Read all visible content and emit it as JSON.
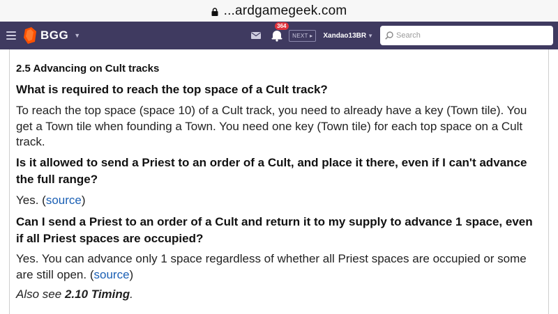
{
  "browser": {
    "domain": "...ardgamegeek.com"
  },
  "nav": {
    "logo_text": "BGG",
    "notification_count": "364",
    "next_label": "NEXT ▸",
    "username": "Xandao13BR",
    "search_placeholder": "Search"
  },
  "content": {
    "section_title": "2.5 Advancing on Cult tracks",
    "q1": "What is required to reach the top space of a Cult track?",
    "a1": "To reach the top space (space 10) of a Cult track, you need to already have a key (Town tile). You get a Town tile when founding a Town. You need one key (Town tile) for each top space on a Cult track.",
    "q2": "Is it allowed to send a Priest to an order of a Cult, and place it there, even if I can't advance the full range?",
    "a2_text": "Yes. (",
    "a2_link": "source",
    "a2_end": ")",
    "q3": "Can I send a Priest to an order of a Cult and return it to my supply to advance 1 space, even if all Priest spaces are occupied?",
    "a3_text": "Yes. You can advance only 1 space regardless of whether all Priest spaces are occupied or some are still open. (",
    "a3_link": "source",
    "a3_end": ")",
    "see_prefix": "Also see ",
    "see_ref": "2.10 Timing",
    "see_suffix": "."
  },
  "colors": {
    "nav_bg": "#3f3a60",
    "logo_orange": "#ff5100",
    "badge_red": "#e0323b",
    "link_blue": "#1a5fb4"
  }
}
